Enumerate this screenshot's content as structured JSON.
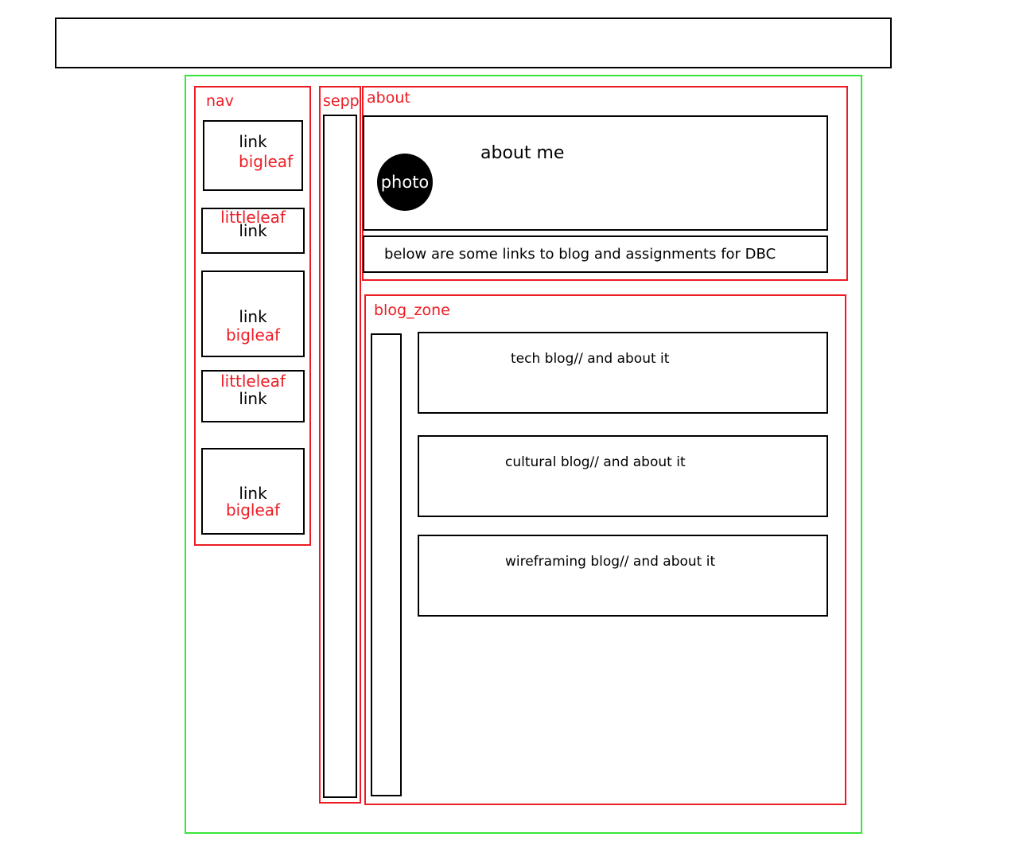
{
  "header": {
    "text": ""
  },
  "nav": {
    "label": "nav",
    "items": [
      {
        "link": "link",
        "leaf": "bigleaf"
      },
      {
        "link": "link",
        "leaf": "littleleaf"
      },
      {
        "link": "link",
        "leaf": "bigleaf"
      },
      {
        "link": "link",
        "leaf": "littleleaf"
      },
      {
        "link": "link",
        "leaf": "bigleaf"
      }
    ]
  },
  "separator": {
    "label": "sepp"
  },
  "about": {
    "label": "about",
    "photo": "photo",
    "about_me": "about me",
    "links_note": "below are some links to blog and assignments for DBC"
  },
  "blog_zone": {
    "label": "blog_zone",
    "blogs": [
      "tech blog// and about it",
      "cultural blog// and about it",
      "wireframing blog// and about it"
    ]
  },
  "colors": {
    "outline": "#000000",
    "container": "#ed1c24",
    "wrapper": "#39e53a"
  }
}
